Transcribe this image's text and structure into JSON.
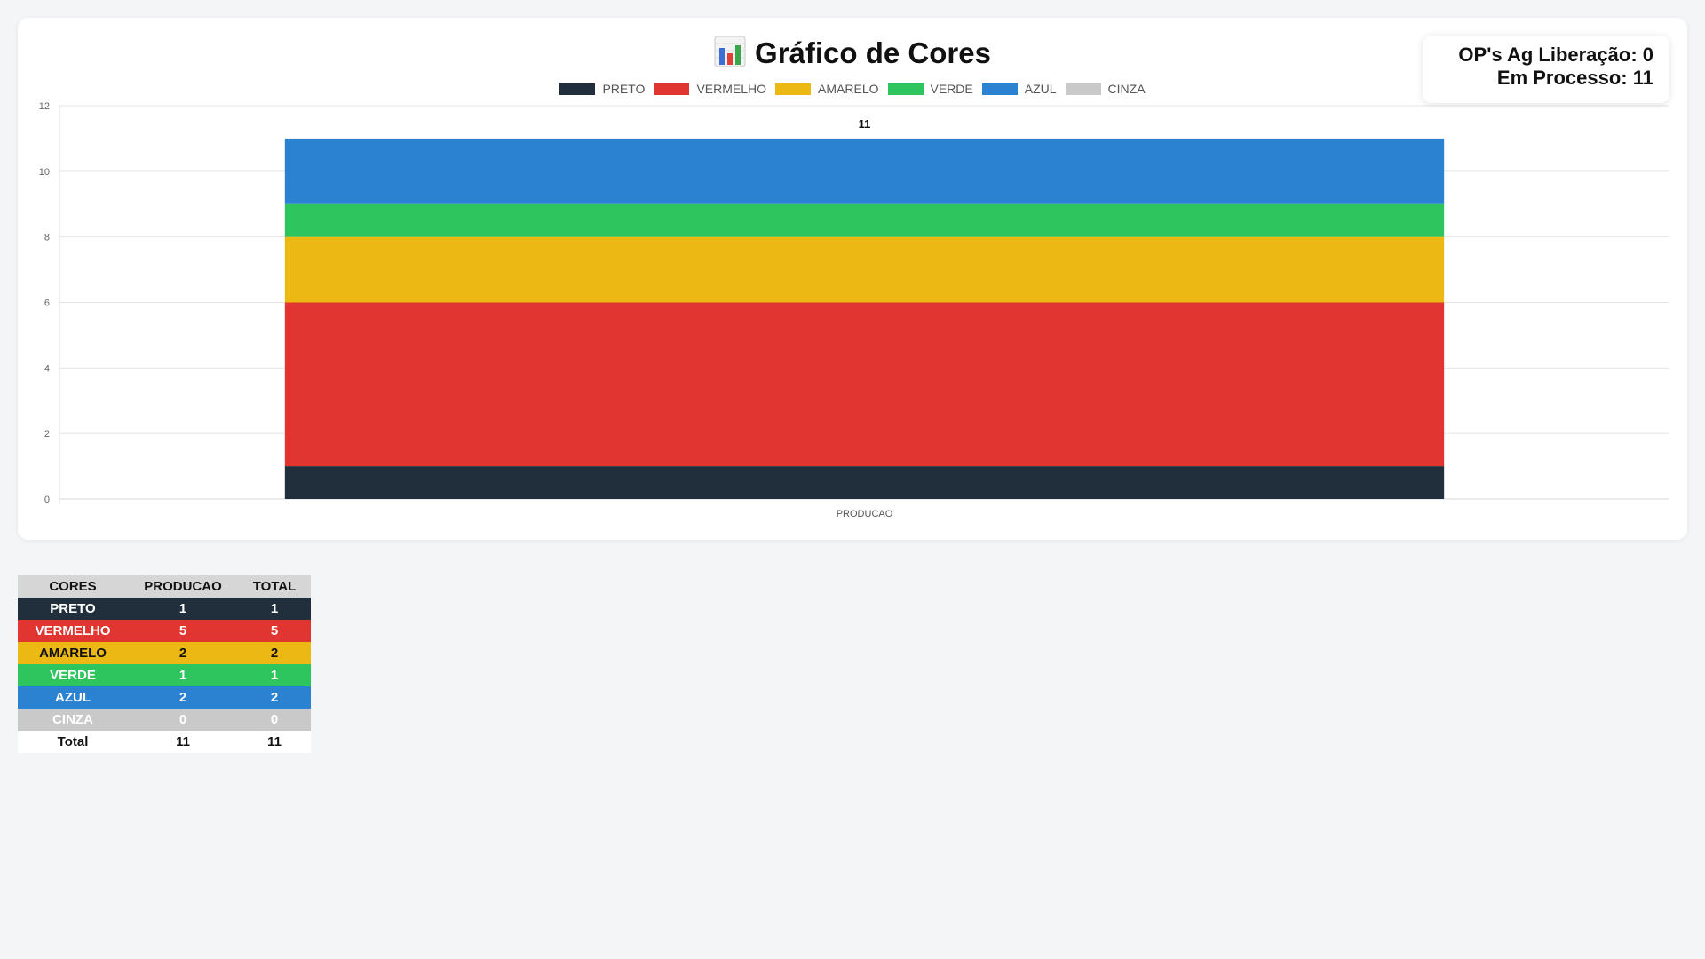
{
  "header": {
    "title": "Gráfico de Cores"
  },
  "summary": {
    "line1": "OP's Ag Liberação: 0",
    "line2": "Em Processo: 11"
  },
  "colors": {
    "PRETO": "#212f3d",
    "VERMELHO": "#e03530",
    "AMARELO": "#ecb813",
    "VERDE": "#2ec45e",
    "AZUL": "#2a82d1",
    "CINZA": "#c9c9c9"
  },
  "chart_data": {
    "type": "bar",
    "stacked": true,
    "categories": [
      "PRODUCAO"
    ],
    "series": [
      {
        "name": "PRETO",
        "values": [
          1
        ]
      },
      {
        "name": "VERMELHO",
        "values": [
          5
        ]
      },
      {
        "name": "AMARELO",
        "values": [
          2
        ]
      },
      {
        "name": "VERDE",
        "values": [
          1
        ]
      },
      {
        "name": "AZUL",
        "values": [
          2
        ]
      },
      {
        "name": "CINZA",
        "values": [
          0
        ]
      }
    ],
    "totals": [
      11
    ],
    "ylim": [
      0,
      12
    ],
    "yticks": [
      0,
      2,
      4,
      6,
      8,
      10,
      12
    ],
    "grid": true,
    "legend": "top"
  },
  "table": {
    "headers": [
      "CORES",
      "PRODUCAO",
      "TOTAL"
    ],
    "rows": [
      {
        "cor": "PRETO",
        "producao": "1",
        "total": "1",
        "text": "#ffffff"
      },
      {
        "cor": "VERMELHO",
        "producao": "5",
        "total": "5",
        "text": "#ffffff"
      },
      {
        "cor": "AMARELO",
        "producao": "2",
        "total": "2",
        "text": "#111111"
      },
      {
        "cor": "VERDE",
        "producao": "1",
        "total": "1",
        "text": "#ffffff"
      },
      {
        "cor": "AZUL",
        "producao": "2",
        "total": "2",
        "text": "#ffffff"
      },
      {
        "cor": "CINZA",
        "producao": "0",
        "total": "0",
        "text": "#ffffff"
      }
    ],
    "total_row": {
      "label": "Total",
      "producao": "11",
      "total": "11"
    }
  }
}
